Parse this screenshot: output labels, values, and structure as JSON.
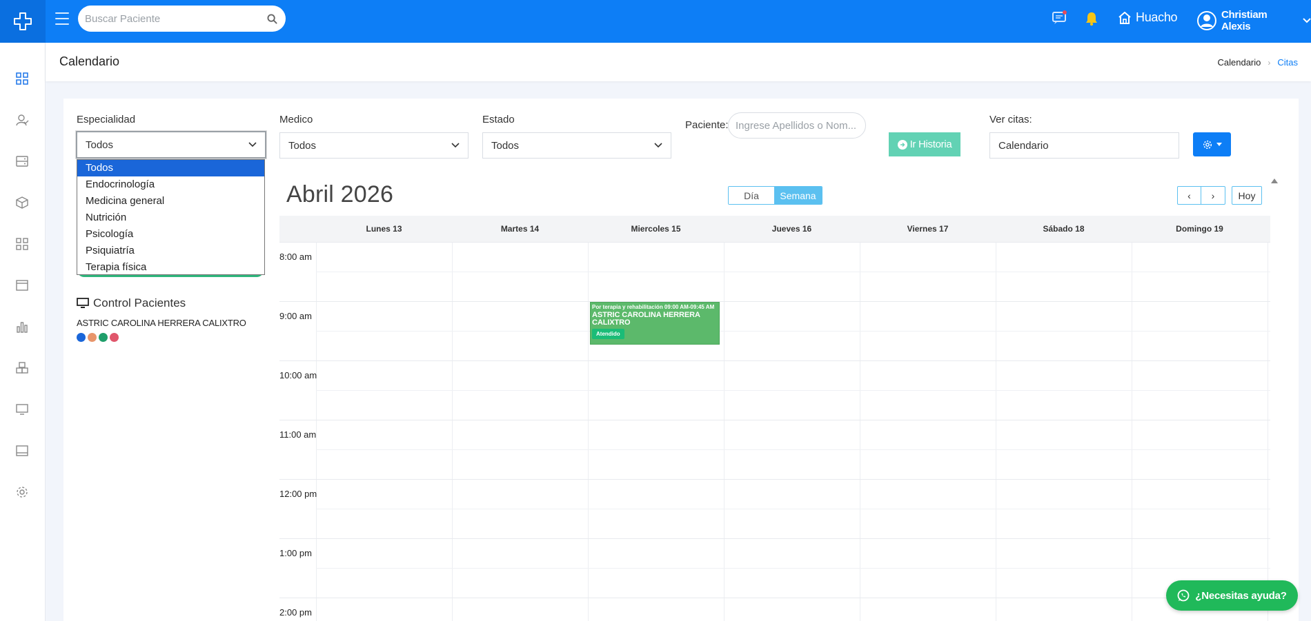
{
  "topbar": {
    "search_placeholder": "Buscar Paciente",
    "location": "Huacho",
    "user_name": "Christiam Alexis"
  },
  "header": {
    "title": "Calendario",
    "breadcrumb": [
      "Calendario",
      "Citas"
    ]
  },
  "filters": {
    "especialidad": {
      "label": "Especialidad",
      "value": "Todos",
      "options": [
        "Todos",
        "Endocrinología",
        "Medicina general",
        "Nutrición",
        "Psicología",
        "Psiquiatría",
        "Terapia física"
      ]
    },
    "medico": {
      "label": "Medico",
      "value": "Todos"
    },
    "estado": {
      "label": "Estado",
      "value": "Todos"
    },
    "paciente": {
      "label": "Paciente:",
      "placeholder": "Ingrese Apellidos o Nom..."
    },
    "ir_historia": "Ir Historia",
    "ver_citas": {
      "label": "Ver citas:",
      "value": "Calendario"
    }
  },
  "control_pacientes": {
    "title": "Control Pacientes",
    "patient": "ASTRIC CAROLINA HERRERA CALIXTRO",
    "dot_colors": [
      "#1a66d9",
      "#e8956b",
      "#1f9e6a",
      "#e0566b"
    ]
  },
  "calendar": {
    "month": "Abril 2026",
    "views": [
      "Día",
      "Semana"
    ],
    "active_view": "Semana",
    "nav": {
      "prev": "‹",
      "next": "›",
      "today": "Hoy"
    },
    "days": [
      "Lunes 13",
      "Martes 14",
      "Miercoles 15",
      "Jueves 16",
      "Viernes 17",
      "Sábado 18",
      "Domingo 19"
    ],
    "hours": [
      "8:00 am",
      "9:00 am",
      "10:00 am",
      "11:00 am",
      "12:00 pm",
      "1:00 pm",
      "2:00 pm"
    ],
    "event": {
      "day": "Miercoles 15",
      "time": "Por terapia y rehabilitación 09:00 AM-09:45 AM",
      "patient": "ASTRIC CAROLINA HERRERA CALIXTRO",
      "status": "Atendido",
      "color": "#5cb96b"
    }
  },
  "help_button": "¿Necesitas ayuda?",
  "colors": {
    "primary": "#0d7ef6",
    "accent": "#5bc0f0",
    "success": "#20b95a"
  }
}
